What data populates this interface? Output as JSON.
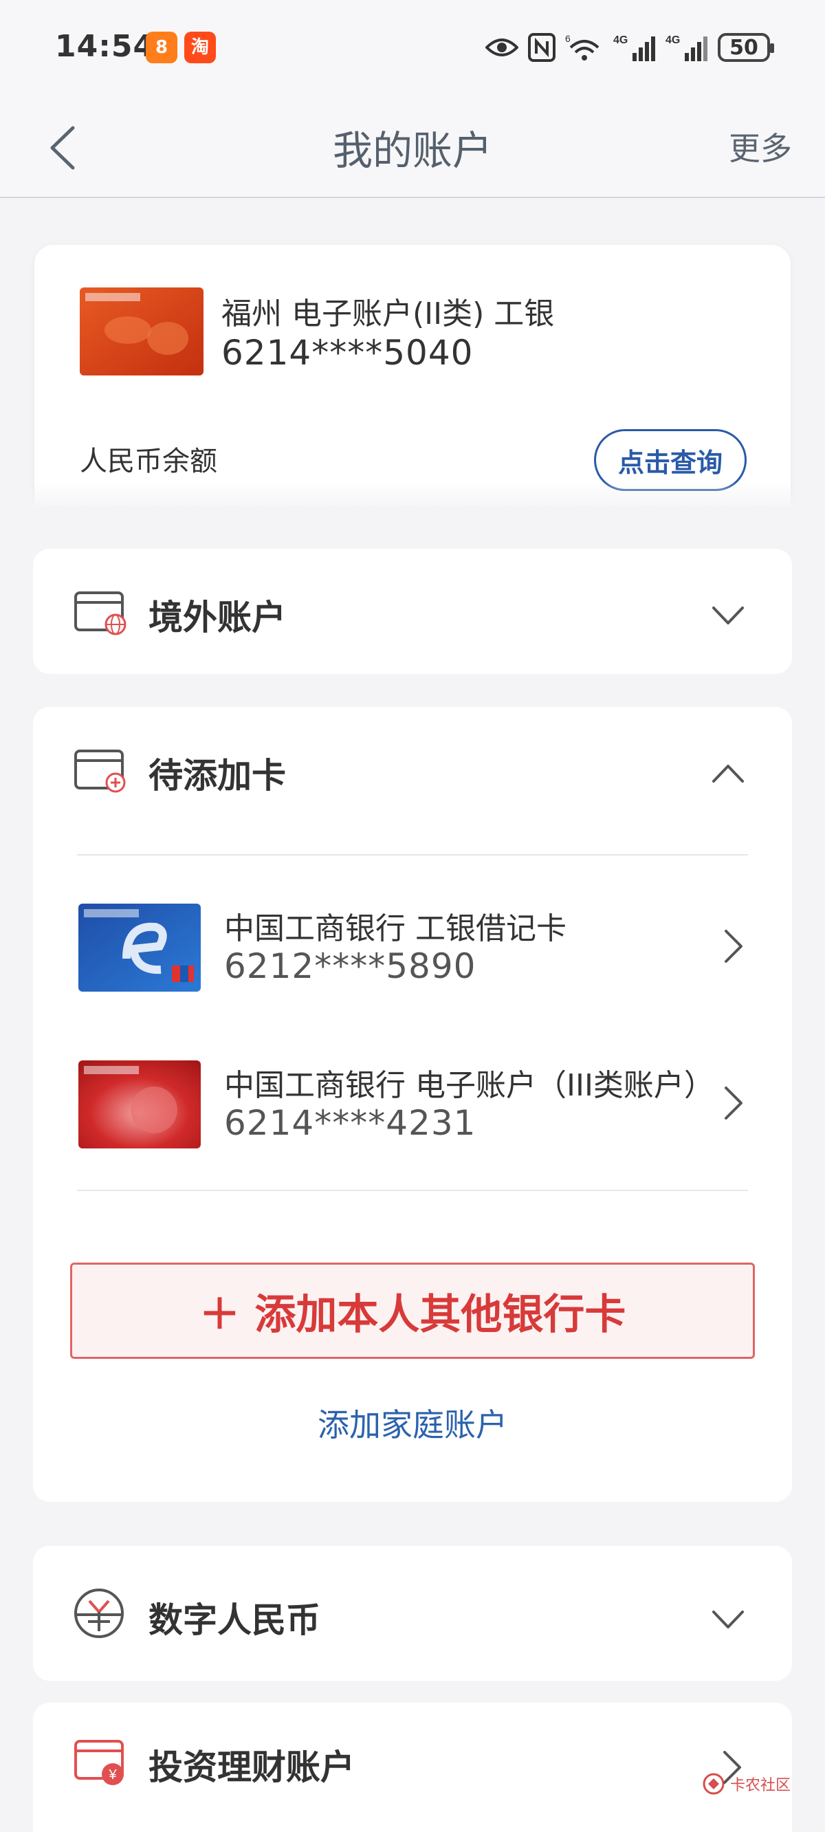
{
  "status_bar": {
    "time": "14:54",
    "app_badges": [
      "8",
      "淘"
    ],
    "battery": "50",
    "network_labels": [
      "6",
      "4G",
      "4G"
    ]
  },
  "nav": {
    "title": "我的账户",
    "more": "更多"
  },
  "account": {
    "name": "福州 电子账户(II类) 工银",
    "number": "6214****5040",
    "balance_label": "人民币余额",
    "query_button": "点击查询"
  },
  "sections": {
    "overseas": {
      "title": "境外账户"
    },
    "pending": {
      "title": "待添加卡",
      "cards": [
        {
          "name": "中国工商银行 工银借记卡",
          "number": "6212****5890"
        },
        {
          "name": "中国工商银行 电子账户（III类账户）",
          "number": "6214****4231"
        }
      ],
      "add_card_button": "＋ 添加本人其他银行卡",
      "add_family_link": "添加家庭账户"
    },
    "digital_rmb": {
      "title": "数字人民币"
    },
    "investment": {
      "title": "投资理财账户"
    }
  },
  "watermark": "卡农社区",
  "colors": {
    "accent_blue": "#2a5aa8",
    "link_blue": "#2c62ad",
    "add_red": "#d83a3a",
    "background": "#f4f4f6"
  }
}
